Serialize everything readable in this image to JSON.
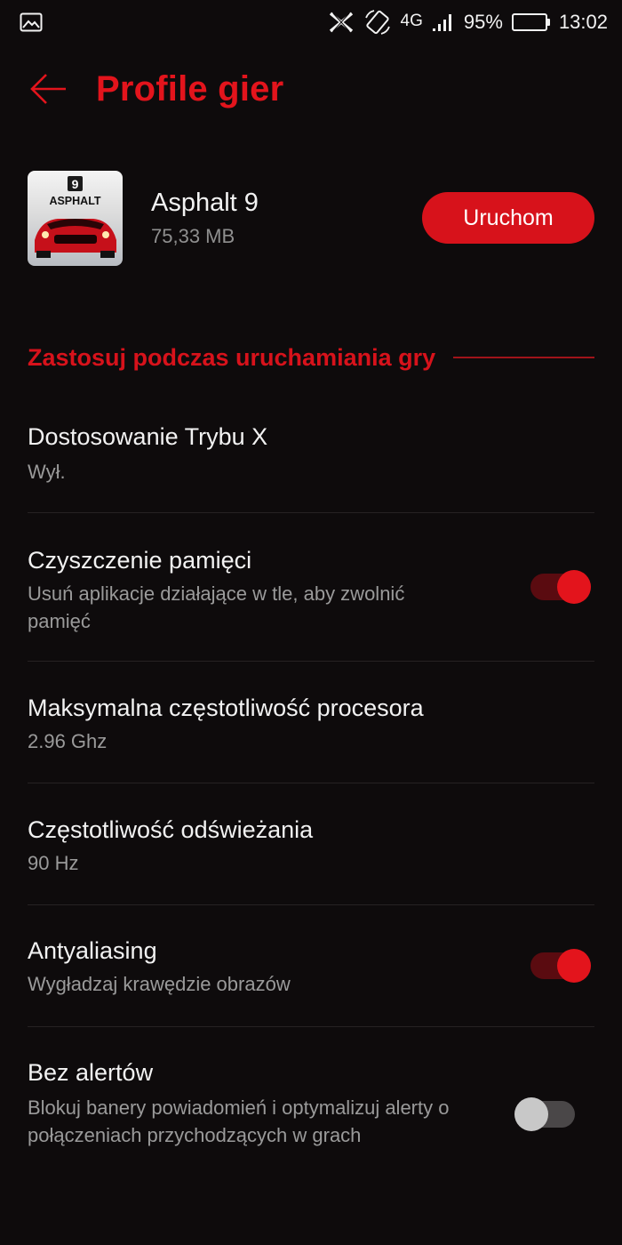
{
  "status_bar": {
    "gallery_icon": "image-icon",
    "x_mode_icon": "x-mode-icon",
    "rotation_icon": "auto-rotate-icon",
    "network": "4G",
    "battery_percent": "95%",
    "battery_level": 0.95,
    "time": "13:02"
  },
  "header": {
    "back_icon": "arrow-left-icon",
    "title": "Profile gier"
  },
  "app": {
    "name": "Asphalt 9",
    "size": "75,33 MB",
    "icon_badge": "9",
    "icon_logo": "ASPHALT",
    "launch_label": "Uruchom"
  },
  "section": {
    "title": "Zastosuj podczas uruchamiania gry"
  },
  "settings": [
    {
      "title": "Dostosowanie Trybu X",
      "subtitle": "Wył.",
      "toggle": null
    },
    {
      "title": "Czyszczenie pamięci",
      "subtitle": "Usuń aplikacje działające w tle, aby zwolnić pamięć",
      "toggle": true
    },
    {
      "title": "Maksymalna częstotliwość procesora",
      "subtitle": "2.96 Ghz",
      "toggle": null
    },
    {
      "title": "Częstotliwość odświeżania",
      "subtitle": "90 Hz",
      "toggle": null
    },
    {
      "title": "Antyaliasing",
      "subtitle": "Wygładzaj krawędzie obrazów",
      "toggle": true
    },
    {
      "title": "Bez alertów",
      "subtitle": "Blokuj banery powiadomień i optymalizuj alerty o połączeniach przychodzących w grach",
      "toggle": false
    }
  ],
  "colors": {
    "accent": "#e3141c",
    "background": "#0e0b0c"
  }
}
